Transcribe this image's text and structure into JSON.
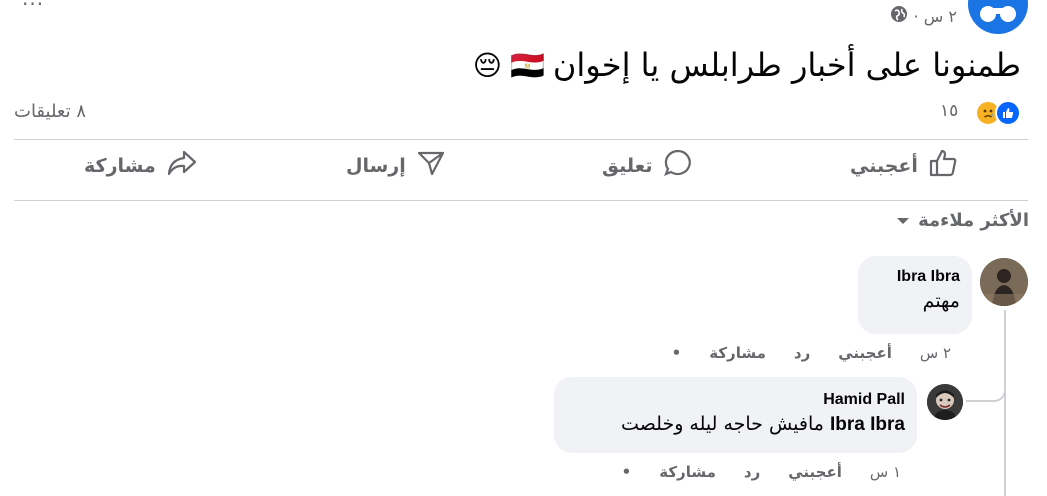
{
  "post": {
    "time": "٢ س ·",
    "text": "طمنونا على أخبار طرابلس يا إخوان",
    "flag": "🇪🇬",
    "emoji": "😔",
    "menu": "..."
  },
  "reactions": {
    "count": "١٥",
    "comments": "٨ تعليقات"
  },
  "actions": {
    "like": "أعجبني",
    "comment": "تعليق",
    "send": "إرسال",
    "share": "مشاركة"
  },
  "sort": {
    "label": "الأكثر ملاءمة"
  },
  "comments": [
    {
      "author": "Ibra Ibra",
      "text": "مهتم",
      "time": "٢ س",
      "like": "أعجبني",
      "reply": "رد",
      "share": "مشاركة"
    },
    {
      "author": "Hamid Pall",
      "mention": "Ibra Ibra",
      "text": "مافيش حاجه ليله وخلصت",
      "time": "١ س",
      "like": "أعجبني",
      "reply": "رد",
      "share": "مشاركة"
    }
  ],
  "colors": {
    "facebook_blue": "#1b74e4",
    "like_blue": "#0866ff",
    "sad_yellow": "#f7b125",
    "muted": "#65676b",
    "bubble": "#f0f2f5"
  }
}
